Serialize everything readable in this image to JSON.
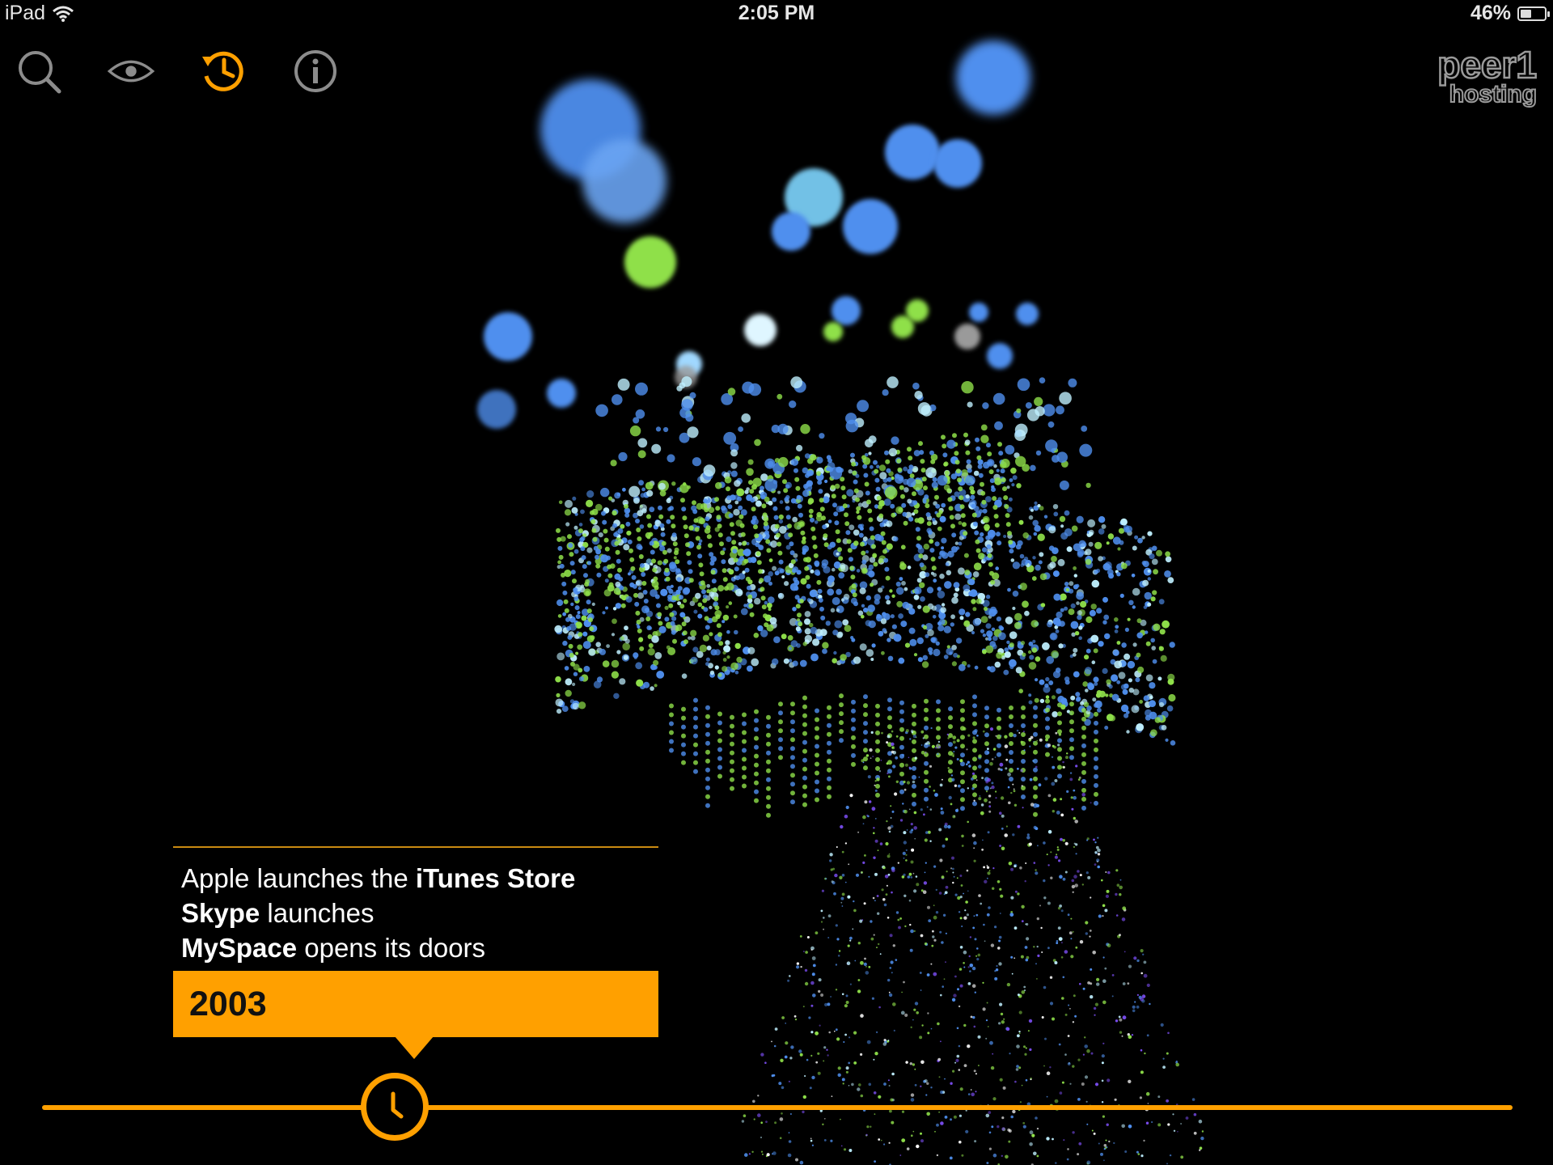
{
  "status_bar": {
    "device": "iPad",
    "time": "2:05 PM",
    "battery": "46%",
    "battery_level": 0.46
  },
  "toolbar": {
    "icons": [
      "search-icon",
      "eye-icon",
      "history-icon",
      "info-icon"
    ],
    "active": "history-icon",
    "accent": "#ffa000",
    "inactive_color": "#8c8c8c"
  },
  "brand": {
    "logo_line1": "peer1",
    "logo_line2": "hosting"
  },
  "event": {
    "lines": [
      {
        "pre": "Apple launches the ",
        "bold": "iTunes Store",
        "post": ""
      },
      {
        "pre": "",
        "bold": "Skype",
        "post": " launches"
      },
      {
        "pre": "",
        "bold": "MySpace",
        "post": " opens its doors"
      }
    ],
    "year": "2003"
  },
  "timeline": {
    "position": 0.24
  },
  "colors": {
    "background": "#000000",
    "accent": "#ffa000",
    "particle_blue": "#4f8fee",
    "particle_green": "#8fe04a",
    "particle_cyan": "#bff0ff"
  }
}
